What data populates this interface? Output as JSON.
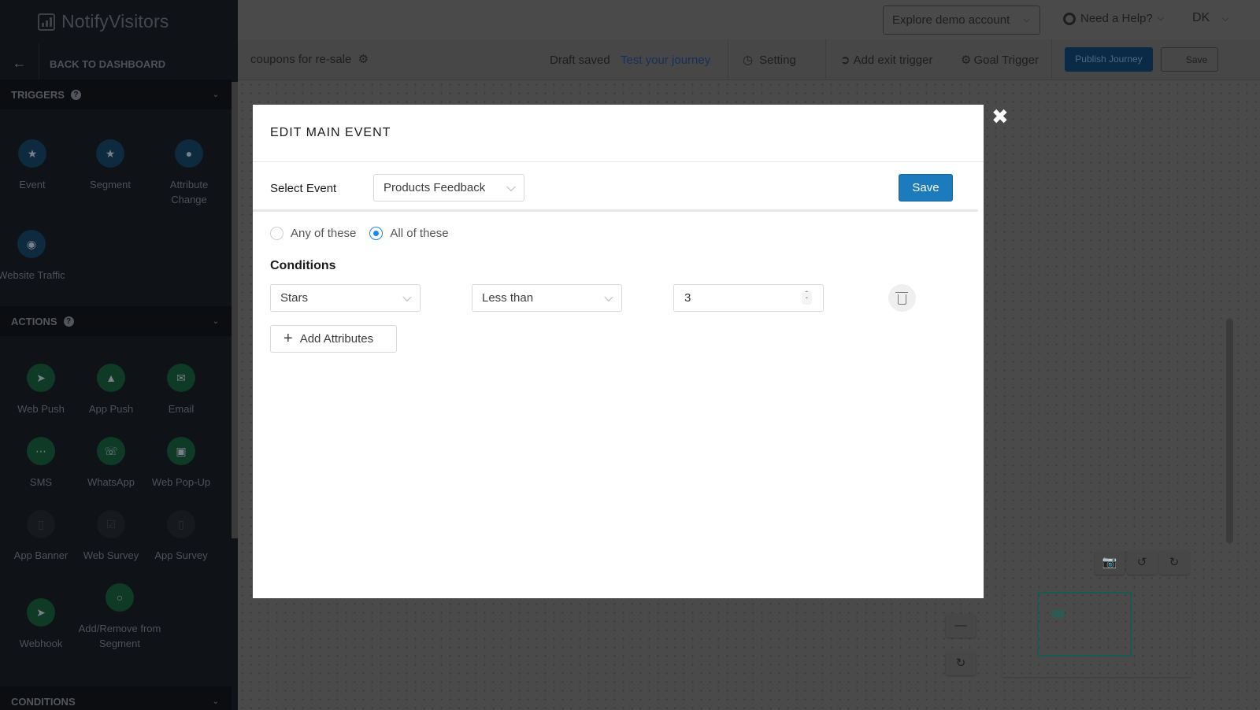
{
  "sidebar": {
    "logo": "NotifyVisitors",
    "back_label": "BACK TO DASHBOARD",
    "sections": {
      "triggers": {
        "title": "TRIGGERS",
        "items": [
          {
            "label": "Event",
            "icon": "star-icon"
          },
          {
            "label": "Segment",
            "icon": "star-icon"
          },
          {
            "label": "Attribute Change",
            "icon": "user-icon"
          },
          {
            "label": "Website Traffic",
            "icon": "globe-icon"
          }
        ]
      },
      "actions": {
        "title": "ACTIONS",
        "items": [
          {
            "label": "Web Push",
            "icon": "paper-plane-icon"
          },
          {
            "label": "App Push",
            "icon": "bell-icon"
          },
          {
            "label": "Email",
            "icon": "envelope-icon"
          },
          {
            "label": "SMS",
            "icon": "chat-icon"
          },
          {
            "label": "WhatsApp",
            "icon": "whatsapp-icon"
          },
          {
            "label": "Web Pop-Up",
            "icon": "image-icon"
          },
          {
            "label": "App Banner",
            "icon": "mobile-icon"
          },
          {
            "label": "Web Survey",
            "icon": "checkbox-icon"
          },
          {
            "label": "App Survey",
            "icon": "mobile-icon"
          },
          {
            "label": "Webhook",
            "icon": "paper-plane-icon"
          },
          {
            "label": "Add/Remove from Segment",
            "icon": "circle-icon"
          }
        ]
      },
      "conditions": {
        "title": "CONDITIONS"
      }
    }
  },
  "header": {
    "demo_account": "Explore demo account",
    "help": "Need a Help?",
    "user_initials": "DK"
  },
  "toolbar": {
    "journey_name": "coupons for re-sale",
    "draft_status": "Draft saved",
    "test_link": "Test your journey",
    "setting": "Setting",
    "exit_trigger": "Add exit trigger",
    "goal_trigger": "Goal Trigger",
    "publish": "Publish Journey",
    "save": "Save"
  },
  "modal": {
    "title": "EDIT MAIN EVENT",
    "select_event_label": "Select Event",
    "selected_event": "Products Feedback",
    "save_label": "Save",
    "match_options": [
      {
        "label": "Any of these",
        "checked": false
      },
      {
        "label": "All of these",
        "checked": true
      }
    ],
    "conditions_title": "Conditions",
    "condition": {
      "attribute": "Stars",
      "operator": "Less than",
      "value": "3"
    },
    "add_attributes_label": "Add Attributes"
  },
  "colors": {
    "primary_blue": "#1b7bbd",
    "radio_blue": "#1a88ea",
    "overlay": "#4a4a4a"
  }
}
